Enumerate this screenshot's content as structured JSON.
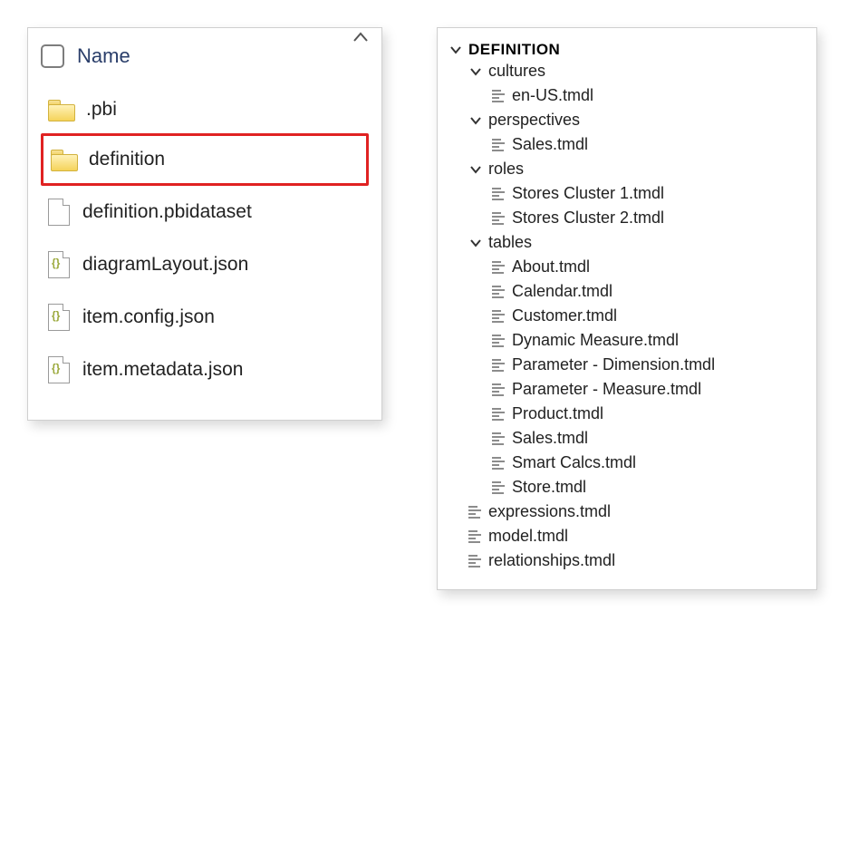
{
  "explorer": {
    "columnHeader": "Name",
    "items": [
      {
        "label": ".pbi",
        "type": "folder"
      },
      {
        "label": "definition",
        "type": "folder",
        "highlighted": true
      },
      {
        "label": "definition.pbidataset",
        "type": "file"
      },
      {
        "label": "diagramLayout.json",
        "type": "file-json"
      },
      {
        "label": "item.config.json",
        "type": "file-json"
      },
      {
        "label": "item.metadata.json",
        "type": "file-json"
      }
    ]
  },
  "tree": {
    "rootLabel": "DEFINITION",
    "groups": [
      {
        "label": "cultures",
        "files": [
          "en-US.tmdl"
        ]
      },
      {
        "label": "perspectives",
        "files": [
          "Sales.tmdl"
        ]
      },
      {
        "label": "roles",
        "files": [
          "Stores Cluster 1.tmdl",
          "Stores Cluster 2.tmdl"
        ]
      },
      {
        "label": "tables",
        "files": [
          "About.tmdl",
          "Calendar.tmdl",
          "Customer.tmdl",
          "Dynamic Measure.tmdl",
          "Parameter - Dimension.tmdl",
          "Parameter - Measure.tmdl",
          "Product.tmdl",
          "Sales.tmdl",
          "Smart Calcs.tmdl",
          "Store.tmdl"
        ]
      }
    ],
    "rootFiles": [
      "expressions.tmdl",
      "model.tmdl",
      "relationships.tmdl"
    ]
  }
}
